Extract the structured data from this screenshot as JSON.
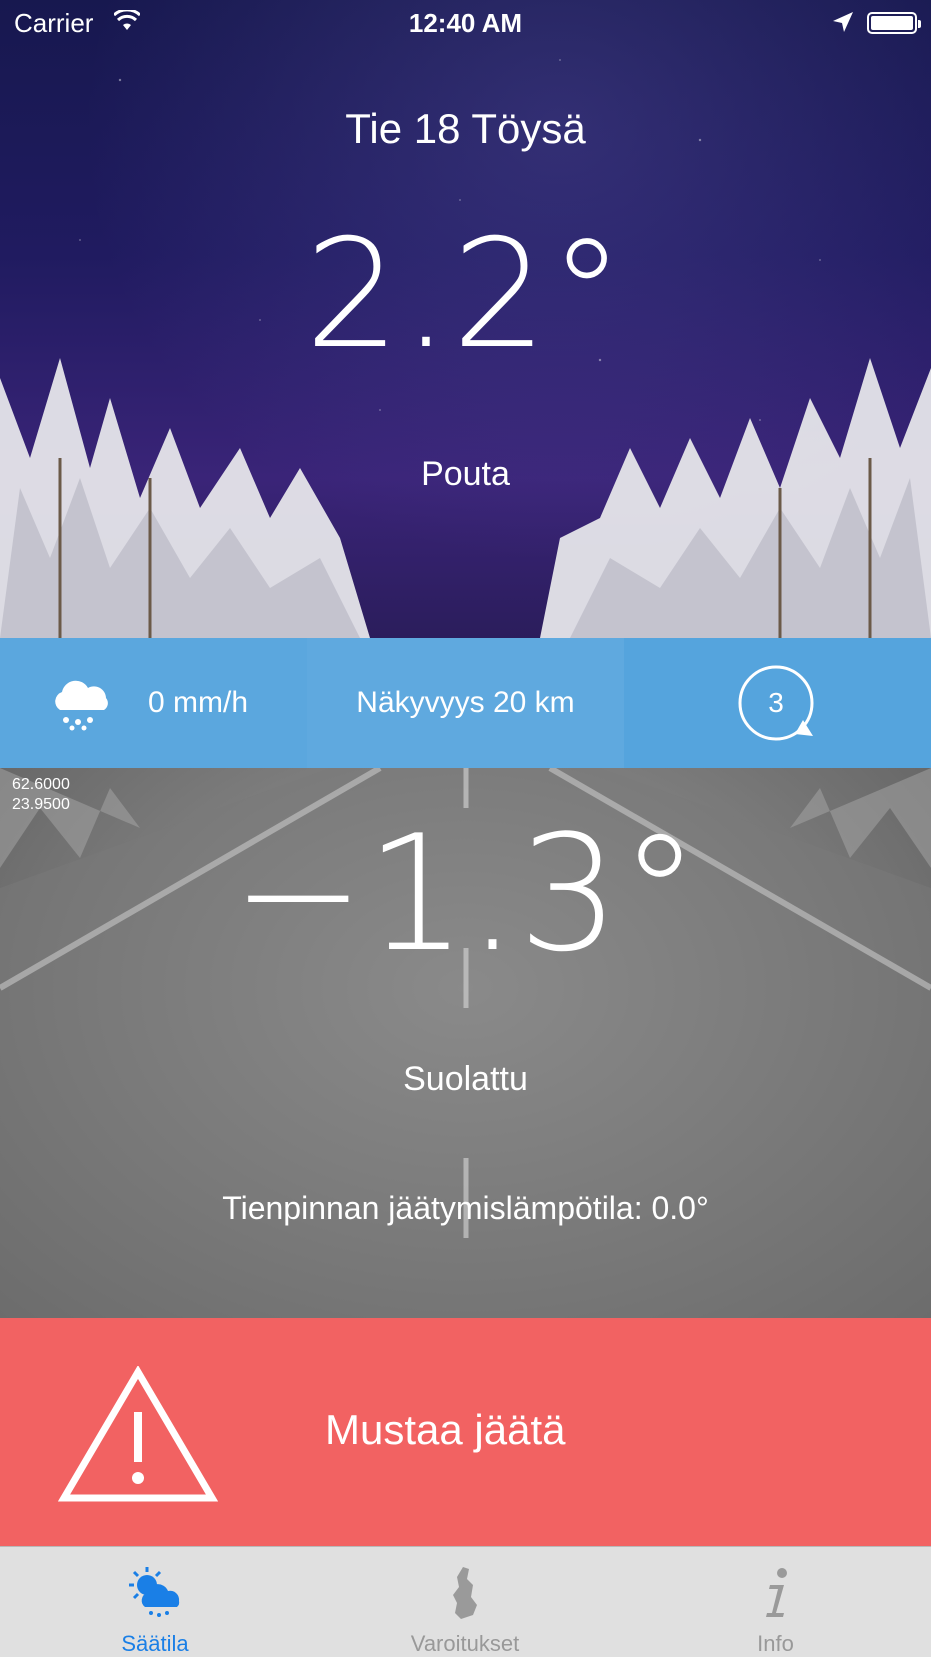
{
  "status_bar": {
    "carrier": "Carrier",
    "time": "12:40 AM"
  },
  "station": {
    "name": "Tie 18 Töysä"
  },
  "air": {
    "temperature": "2.2°",
    "condition": "Pouta"
  },
  "info_bar": {
    "precipitation": "0 mm/h",
    "visibility": "Näkyvyys 20 km",
    "wind_value": "3"
  },
  "coordinates": {
    "lat": "62.6000",
    "lon": "23.9500"
  },
  "road": {
    "temperature": "−1.3°",
    "condition": "Suolattu",
    "freezing_point": "Tienpinnan jäätymislämpötila: 0.0°"
  },
  "warning": {
    "text": "Mustaa jäätä",
    "color": "#f26262"
  },
  "tabs": [
    {
      "label": "Säätila",
      "icon": "weather-icon",
      "active": true
    },
    {
      "label": "Varoitukset",
      "icon": "finland-map-icon",
      "active": false
    },
    {
      "label": "Info",
      "icon": "info-icon",
      "active": false
    }
  ],
  "colors": {
    "accent": "#1a7fe6",
    "info_bar": "#5aafe8",
    "warning": "#f26262"
  }
}
